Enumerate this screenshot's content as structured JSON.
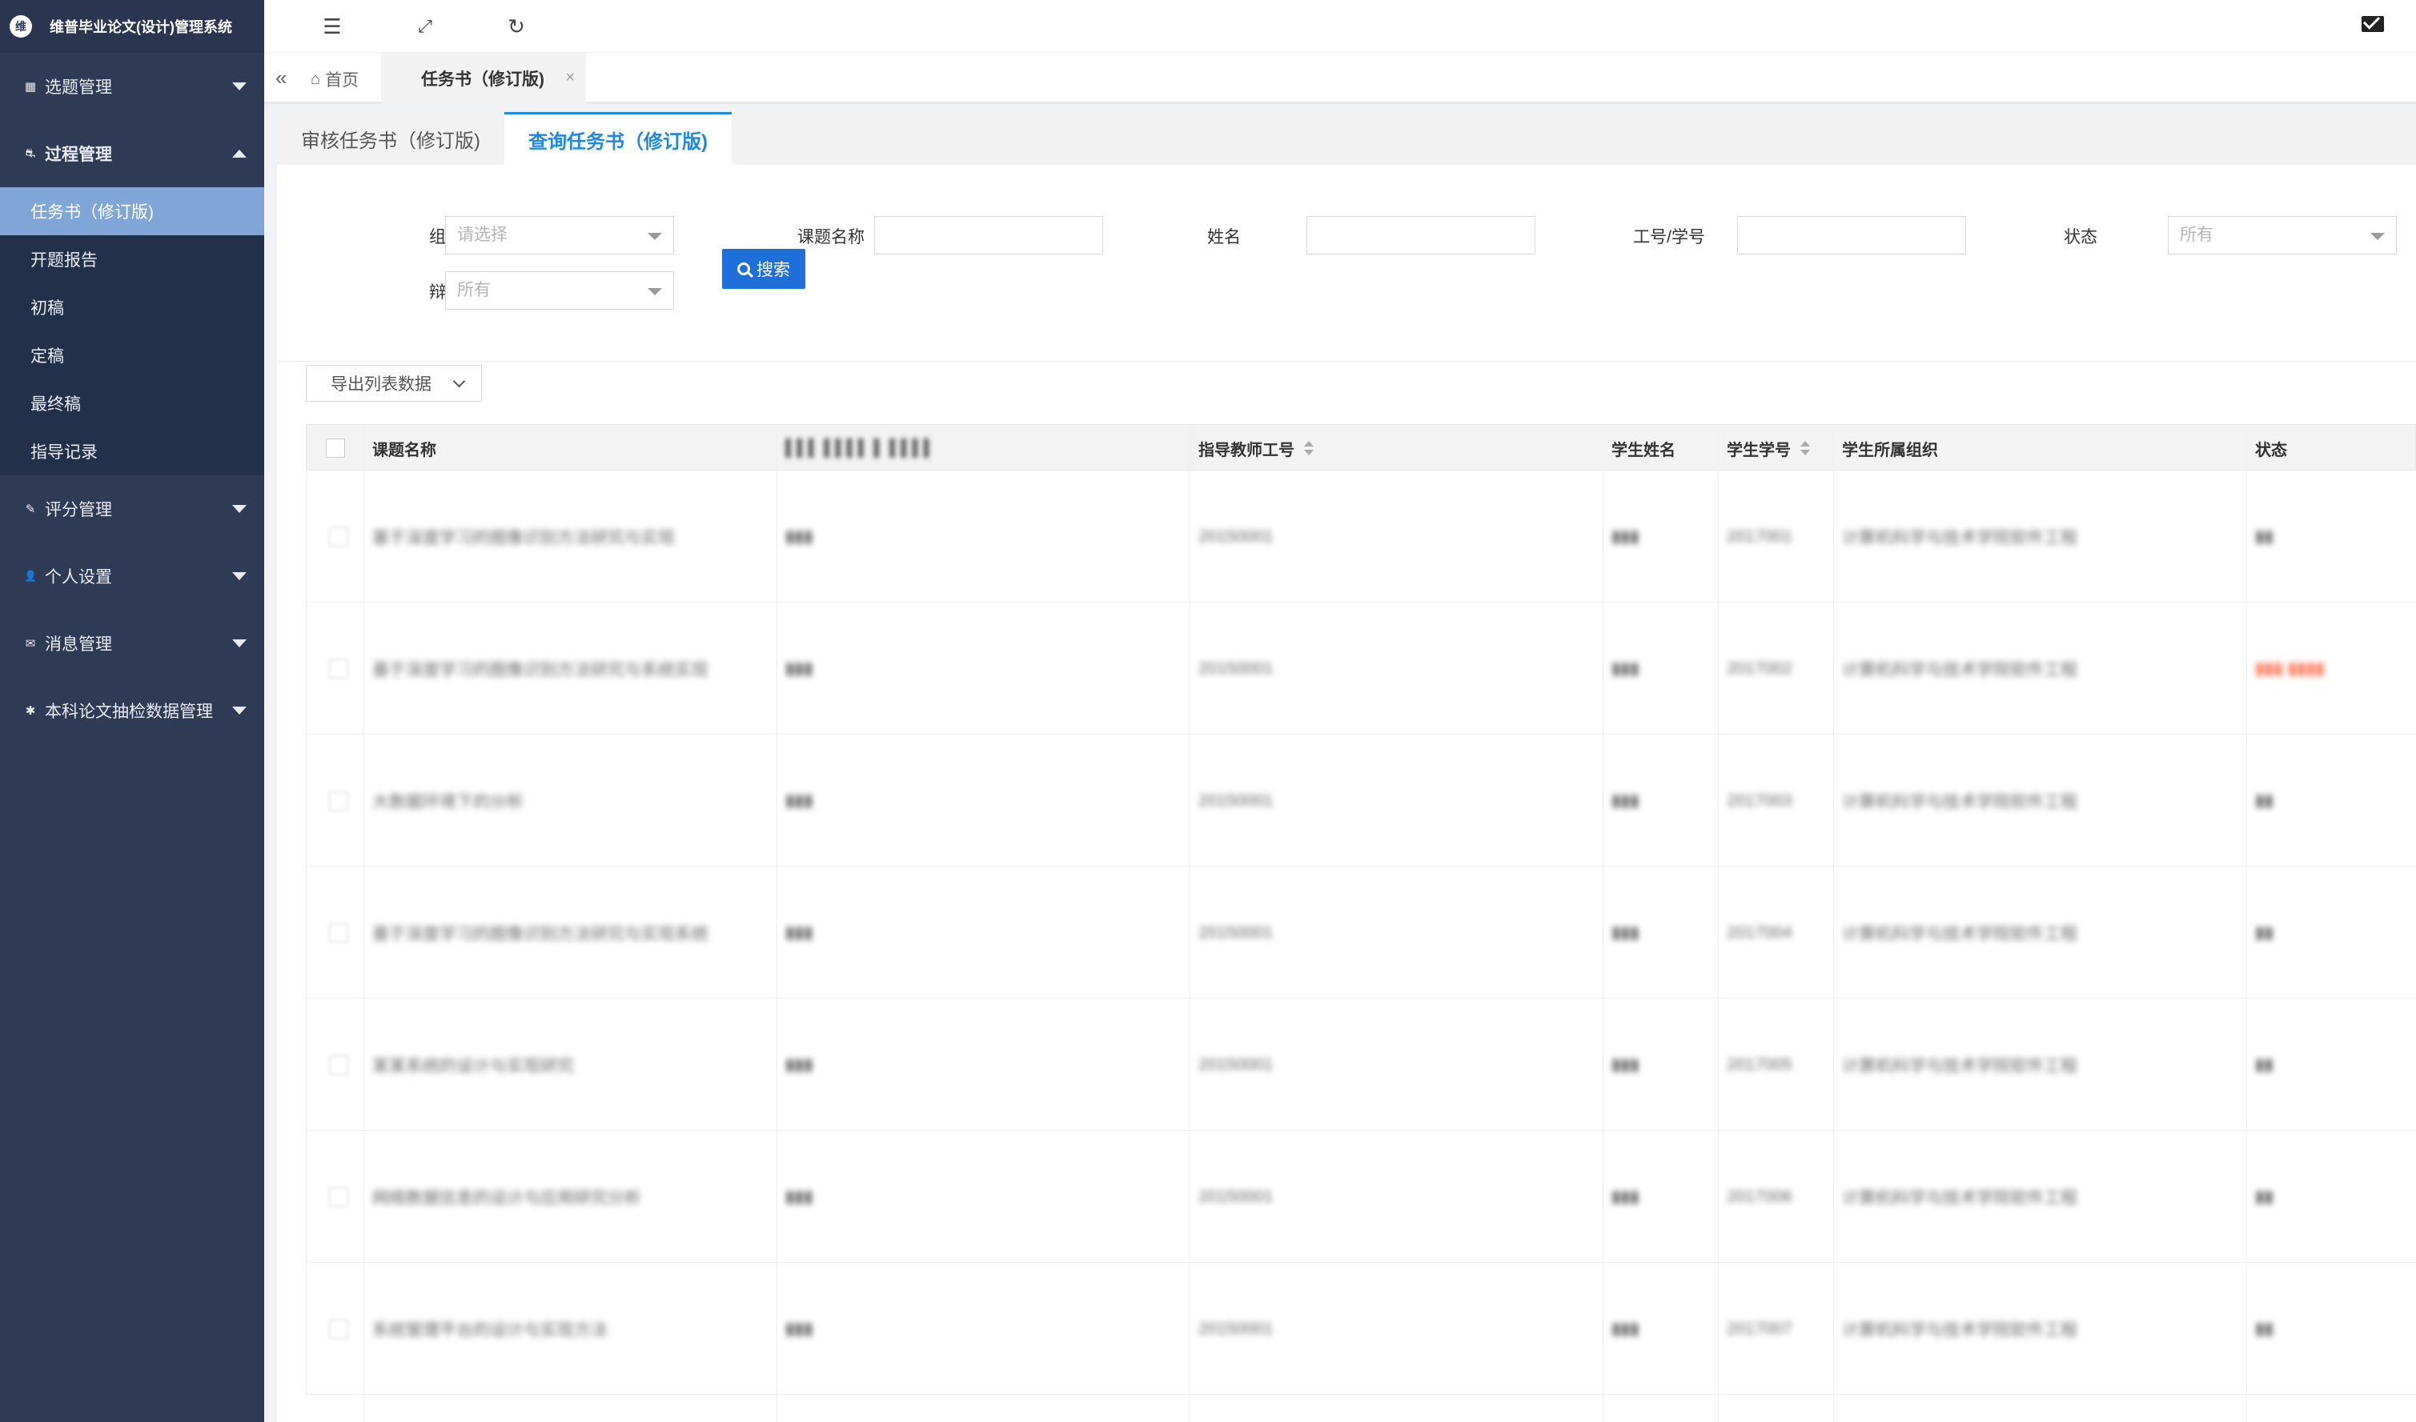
{
  "app": {
    "title": "维普毕业论文(设计)管理系统",
    "logo_glyph": "维"
  },
  "sidebar": {
    "groups": [
      {
        "label": "选题管理",
        "icon": "grid-icon",
        "glyph": "▦",
        "expanded": false
      },
      {
        "label": "过程管理",
        "icon": "process-icon",
        "glyph": "⛐",
        "expanded": true,
        "items": [
          {
            "label": "任务书（修订版)",
            "active": true
          },
          {
            "label": "开题报告"
          },
          {
            "label": "初稿"
          },
          {
            "label": "定稿"
          },
          {
            "label": "最终稿"
          },
          {
            "label": "指导记录"
          }
        ]
      },
      {
        "label": "评分管理",
        "icon": "edit-icon",
        "glyph": "✎",
        "expanded": false
      },
      {
        "label": "个人设置",
        "icon": "user-icon",
        "glyph": "👤",
        "expanded": false
      },
      {
        "label": "消息管理",
        "icon": "message-icon",
        "glyph": "✉",
        "expanded": false
      },
      {
        "label": "本科论文抽检数据管理",
        "icon": "gear-icon",
        "glyph": "✱",
        "expanded": false
      }
    ]
  },
  "topbar": {
    "icons": [
      "collapse-menu-icon",
      "fullscreen-icon",
      "refresh-icon",
      "mail-icon"
    ]
  },
  "tabs": {
    "home": "首页",
    "current": "任务书（修订版)"
  },
  "subtabs": [
    {
      "label": "审核任务书（修订版)",
      "active": false
    },
    {
      "label": "查询任务书（修订版)",
      "active": true
    }
  ],
  "filters": {
    "org": {
      "label": "组织",
      "placeholder": "请选择"
    },
    "topic": {
      "label": "课题名称",
      "value": ""
    },
    "name": {
      "label": "姓名",
      "value": ""
    },
    "id": {
      "label": "工号/学号",
      "value": ""
    },
    "status": {
      "label": "状态",
      "value": "所有"
    },
    "defense": {
      "label": "辩次",
      "value": "所有"
    },
    "search_label": "搜索"
  },
  "export_label": "导出列表数据",
  "table": {
    "columns": [
      "课题名称",
      "▌▌▌ ▌▌▌▌ ▌ ▌▌▌▌",
      "指导教师工号",
      "学生姓名",
      "学生学号",
      "学生所属组织",
      "状态"
    ],
    "rows": [
      [
        "基于深度学习的图像识别方法研究与实现",
        "▮▮▮",
        "20150001",
        "▮▮▮",
        "2017001",
        "计算机科学与技术学院软件工程",
        "▮▮"
      ],
      [
        "基于深度学习的图像识别方法研究与系统实现",
        "▮▮▮",
        "20150001",
        "▮▮▮",
        "2017002",
        "计算机科学与技术学院软件工程",
        "▮▮▮ ▮▮▮▮"
      ],
      [
        "大数据环境下的分析",
        "▮▮▮",
        "20150001",
        "▮▮▮",
        "2017003",
        "计算机科学与技术学院软件工程",
        "▮▮"
      ],
      [
        "基于深度学习的图像识别方法研究与实现系统",
        "▮▮▮",
        "20150001",
        "▮▮▮",
        "2017004",
        "计算机科学与技术学院软件工程",
        "▮▮"
      ],
      [
        "某某系统的设计与实现研究",
        "▮▮▮",
        "20150001",
        "▮▮▮",
        "2017005",
        "计算机科学与技术学院软件工程",
        "▮▮"
      ],
      [
        "网络数据信息的设计与应用研究分析",
        "▮▮▮",
        "20150001",
        "▮▮▮",
        "2017006",
        "计算机科学与技术学院软件工程",
        "▮▮"
      ],
      [
        "系统管理平台的设计与实现方法",
        "▮▮▮",
        "20150001",
        "▮▮▮",
        "2017007",
        "计算机科学与技术学院软件工程",
        "▮▮"
      ]
    ]
  }
}
